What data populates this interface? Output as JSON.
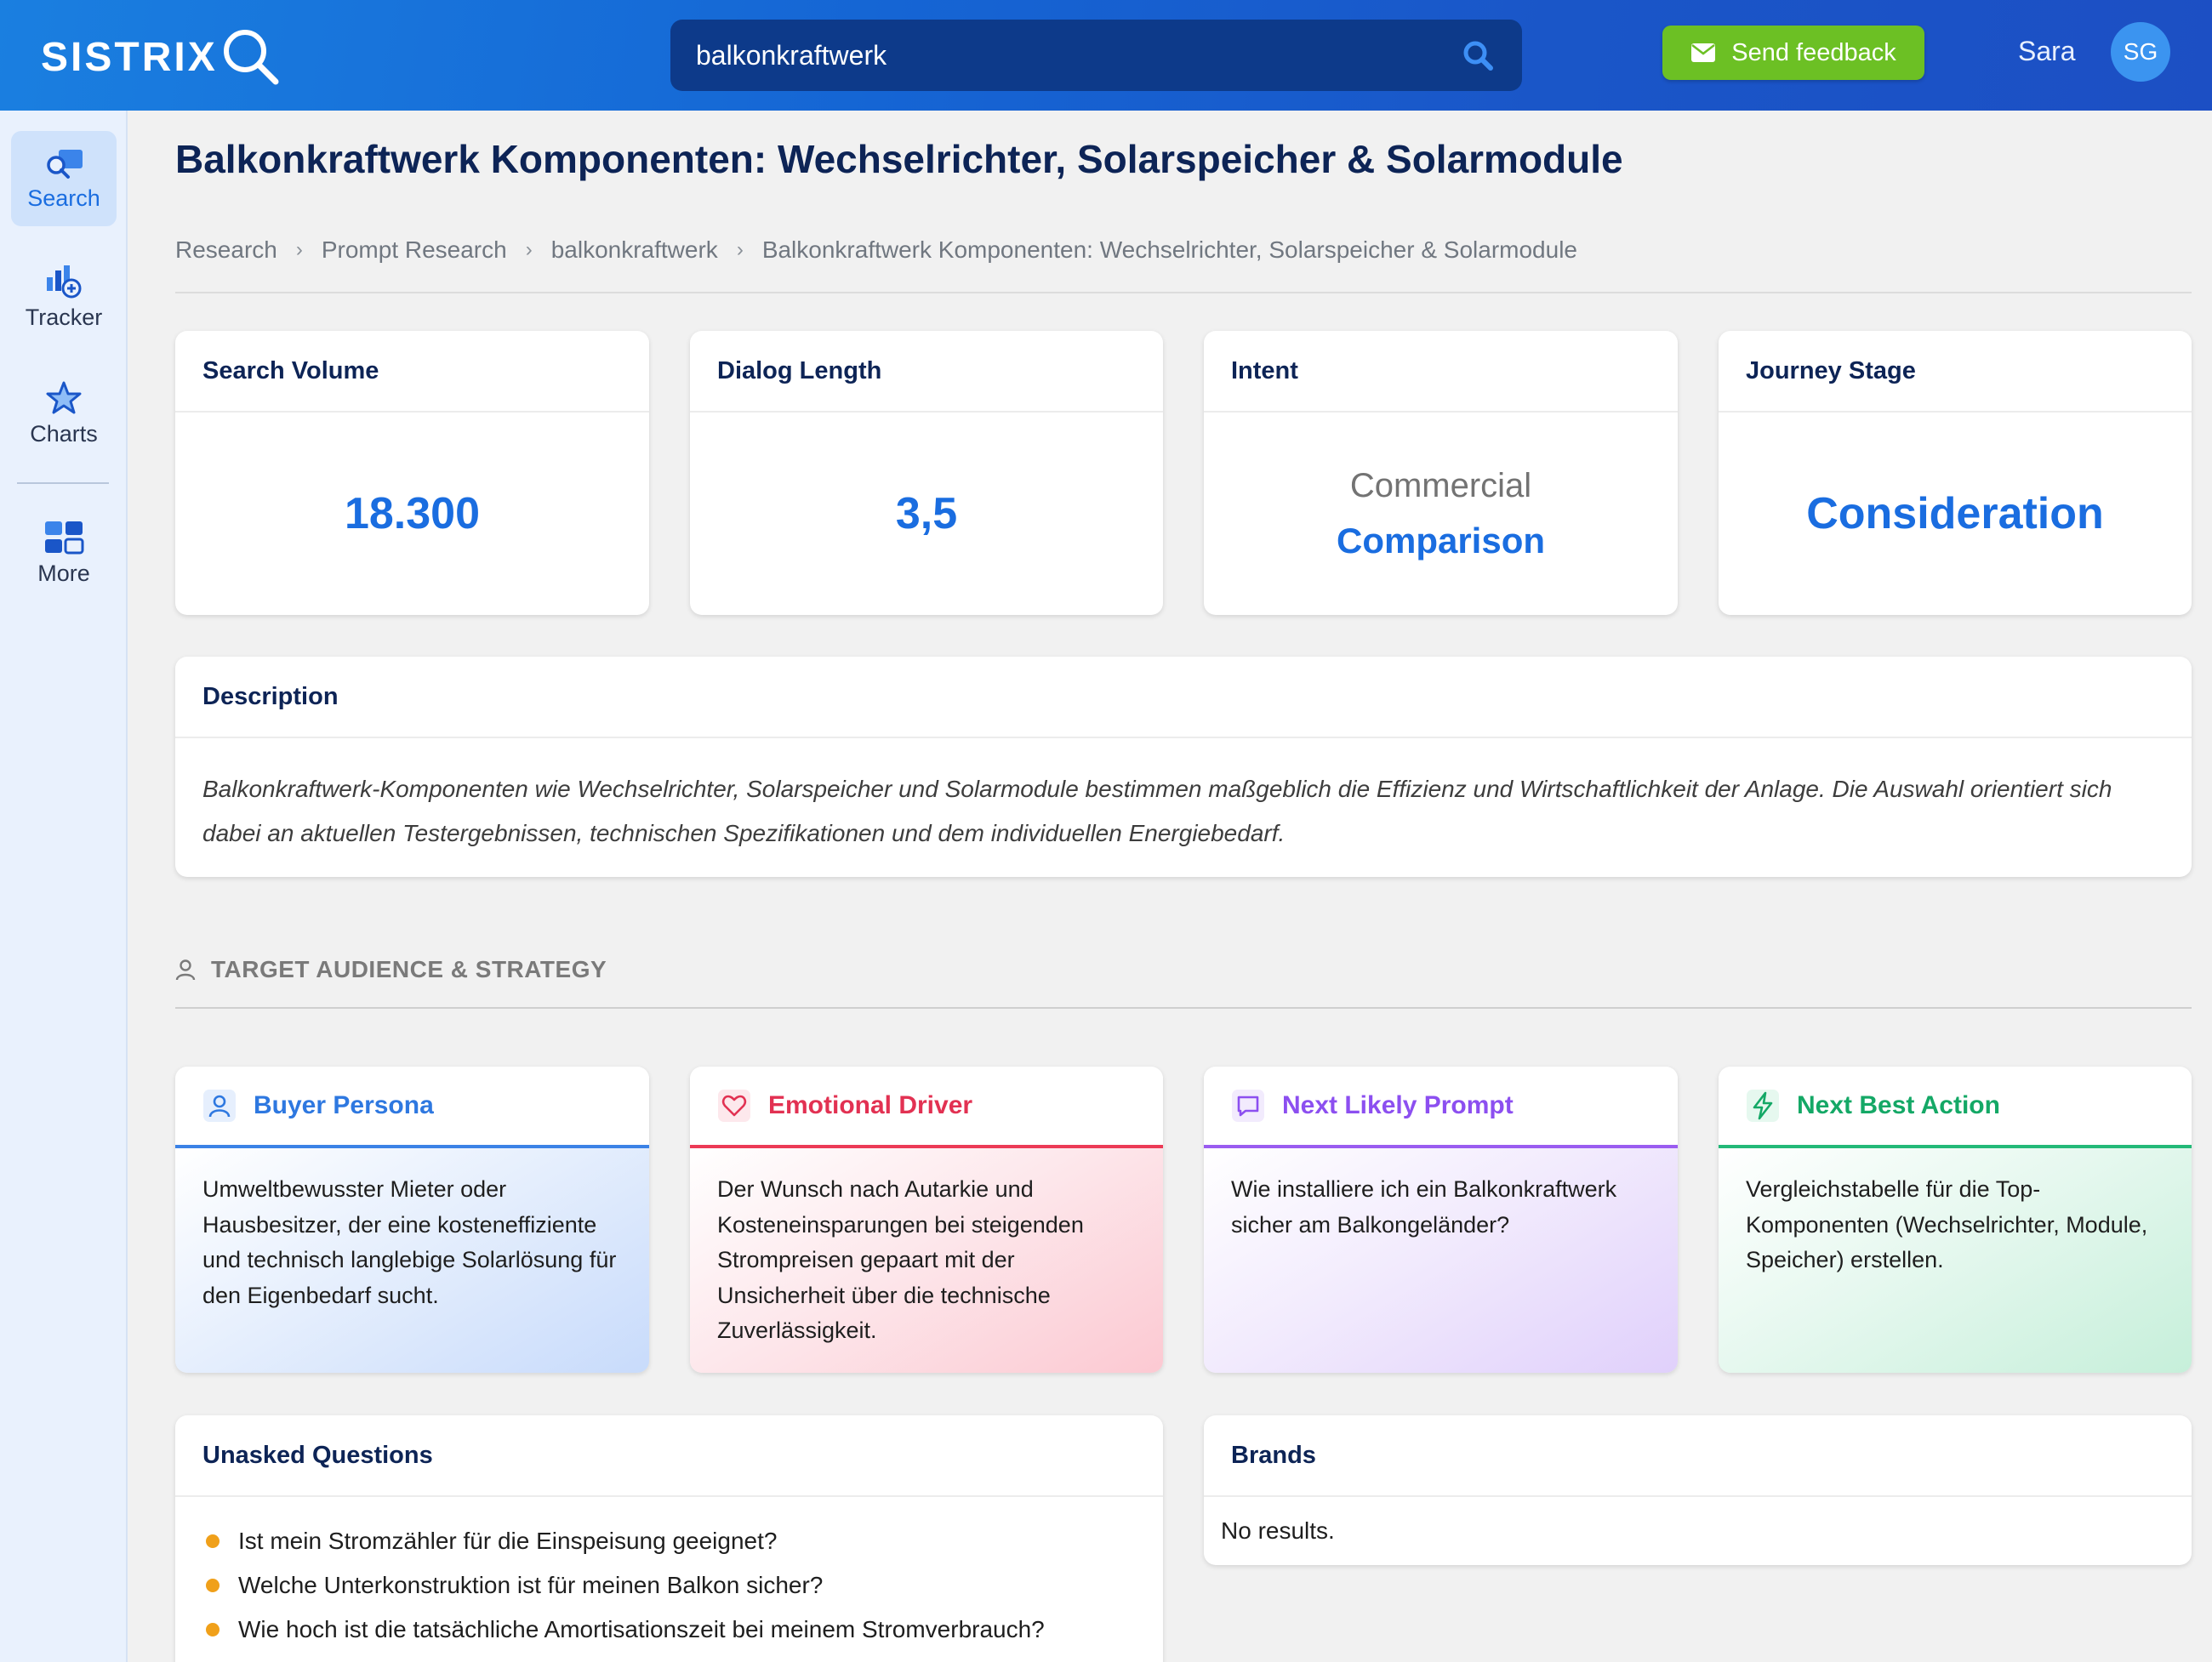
{
  "header": {
    "logo_text": "SISTRIX",
    "search_value": "balkonkraftwerk",
    "feedback_label": "Send feedback",
    "user_name": "Sara",
    "avatar_initials": "SG"
  },
  "sidebar": {
    "items": [
      {
        "label": "Search",
        "icon": "search-icon",
        "active": true
      },
      {
        "label": "Tracker",
        "icon": "tracker-chart-icon",
        "active": false
      },
      {
        "label": "Charts",
        "icon": "charts-star-icon",
        "active": false
      },
      {
        "label": "More",
        "icon": "grid-icon",
        "active": false
      }
    ]
  },
  "page": {
    "title": "Balkonkraftwerk Komponenten: Wechselrichter, Solarspeicher & Solarmodule",
    "breadcrumb": [
      "Research",
      "Prompt Research",
      "balkonkraftwerk",
      "Balkonkraftwerk Komponenten: Wechselrichter, Solarspeicher & Solarmodule"
    ]
  },
  "metrics": {
    "search_volume": {
      "label": "Search Volume",
      "value": "18.300"
    },
    "dialog_length": {
      "label": "Dialog Length",
      "value": "3,5"
    },
    "intent": {
      "label": "Intent",
      "sub": "Commercial",
      "value": "Comparison"
    },
    "journey_stage": {
      "label": "Journey Stage",
      "value": "Consideration"
    }
  },
  "description": {
    "label": "Description",
    "text": "Balkonkraftwerk-Komponenten wie Wechselrichter, Solarspeicher und Solarmodule bestimmen maßgeblich die Effizienz und Wirtschaftlichkeit der Anlage. Die Auswahl orientiert sich dabei an aktuellen Testergebnissen, technischen Spezifikationen und dem individuellen Energiebedarf."
  },
  "audience": {
    "section_label": "TARGET AUDIENCE & STRATEGY",
    "cards": {
      "persona": {
        "label": "Buyer Persona",
        "text": "Umweltbewusster Mieter oder Hausbesitzer, der eine kosteneffiziente und technisch langlebige Solarlösung für den Eigenbedarf sucht.",
        "color": "#2e78e0"
      },
      "emotional": {
        "label": "Emotional Driver",
        "text": "Der Wunsch nach Autarkie und Kosteneinsparungen bei steigenden Strompreisen gepaart mit der Unsicherheit über die technische Zuverlässigkeit.",
        "color": "#e23152"
      },
      "next_prompt": {
        "label": "Next Likely Prompt",
        "text": "Wie installiere ich ein Balkonkraftwerk sicher am Balkongeländer?",
        "color": "#8c4ff0"
      },
      "next_action": {
        "label": "Next Best Action",
        "text": "Vergleichstabelle für die Top-Komponenten (Wechselrichter, Module, Speicher) erstellen.",
        "color": "#14a866"
      }
    }
  },
  "unasked": {
    "label": "Unasked Questions",
    "items": [
      "Ist mein Stromzähler für die Einspeisung geeignet?",
      "Welche Unterkonstruktion ist für meinen Balkon sicher?",
      "Wie hoch ist die tatsächliche Amortisationszeit bei meinem Stromverbrauch?"
    ]
  },
  "brands": {
    "label": "Brands",
    "empty_text": "No results."
  },
  "colors": {
    "brand_blue": "#1a6de0",
    "feedback_green": "#6cc024",
    "bullet_orange": "#f0a01a"
  }
}
